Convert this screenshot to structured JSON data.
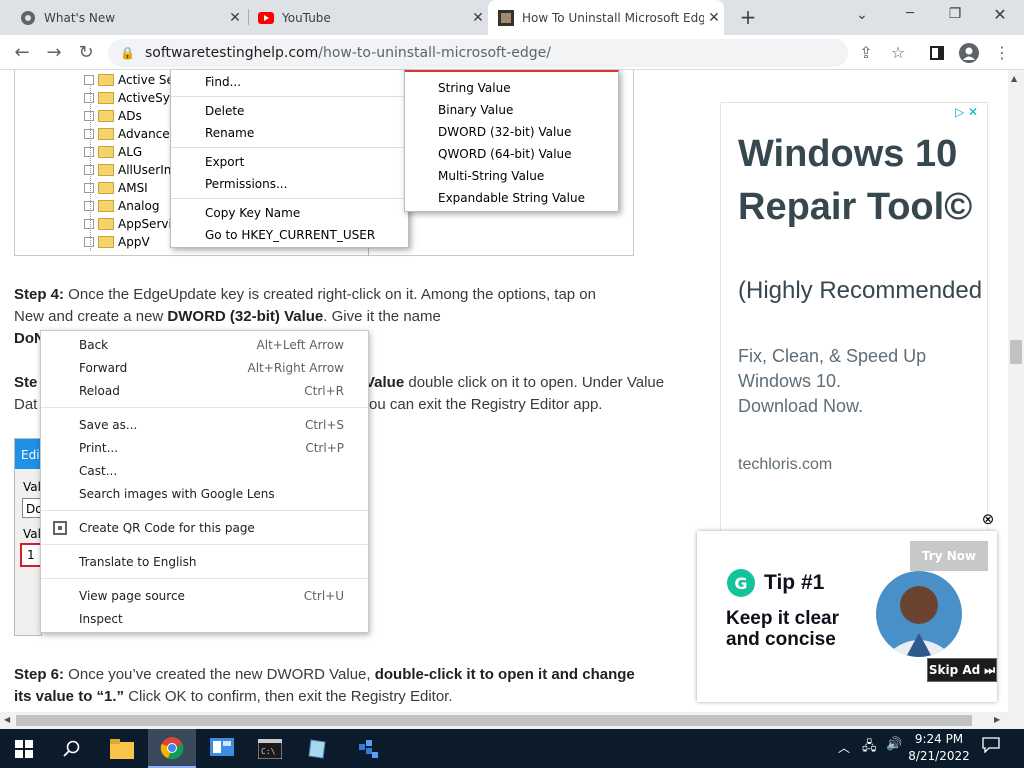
{
  "tabs": [
    {
      "title": "What's New",
      "icon": "chrome-icon"
    },
    {
      "title": "YouTube",
      "icon": "youtube-icon"
    },
    {
      "title": "How To Uninstall Microsoft Edge",
      "icon": "site-favicon"
    }
  ],
  "new_tab": "+",
  "window_controls": {
    "minimize": "─",
    "restore": "❐",
    "close": "✕",
    "tab_search": "⌄"
  },
  "address": {
    "domain": "softwaretestinghelp.com",
    "path": "/how-to-uninstall-microsoft-edge/"
  },
  "registry": {
    "tree_items": [
      "Active Set",
      "ActiveSyn",
      "ADs",
      "Advanced",
      "ALG",
      "AllUserIns",
      "AMSI",
      "Analog",
      "AppServic",
      "AppV"
    ],
    "context_items": [
      "Find...",
      "Delete",
      "Rename",
      "Export",
      "Permissions...",
      "Copy Key Name",
      "Go to HKEY_CURRENT_USER"
    ],
    "submenu_items": [
      "String Value",
      "Binary Value",
      "DWORD (32-bit) Value",
      "QWORD (64-bit) Value",
      "Multi-String Value",
      "Expandable String Value"
    ]
  },
  "article": {
    "step4_label": "Step 4:",
    "step4_text1": " Once the EdgeUpdate key is created right-click on it. Among the options, tap on",
    "step4_text2a": "New and create a new ",
    "step4_bold": "DWORD (32-bit) Value",
    "step4_text2b": ". Give it the name",
    "step4_line3": "DoN",
    "step5_label": "Ste",
    "step5_bold": "Value",
    "step5_text1": " double click on it to open. Under Value",
    "step5_line2a": "Dat",
    "step5_line2b": "ou can exit the Registry Editor app.",
    "dialog_tab": "Edi",
    "dialog_val1": "Valu",
    "dialog_field1": "Do",
    "dialog_val2": "Valu",
    "dialog_field2": "1",
    "step6_label": "Step 6:",
    "step6_text1": " Once you’ve created the new DWORD Value, ",
    "step6_bold1": "double-click it to open it and change",
    "step6_bold2": "its value to “1.”",
    "step6_text2": " Click OK to confirm, then exit the Registry Editor."
  },
  "chrome_menu": {
    "groups": [
      [
        {
          "label": "Back",
          "shortcut": "Alt+Left Arrow"
        },
        {
          "label": "Forward",
          "shortcut": "Alt+Right Arrow"
        },
        {
          "label": "Reload",
          "shortcut": "Ctrl+R"
        }
      ],
      [
        {
          "label": "Save as...",
          "shortcut": "Ctrl+S"
        },
        {
          "label": "Print...",
          "shortcut": "Ctrl+P"
        },
        {
          "label": "Cast...",
          "shortcut": ""
        },
        {
          "label": "Search images with Google Lens",
          "shortcut": ""
        }
      ],
      [
        {
          "label": "Create QR Code for this page",
          "shortcut": ""
        }
      ],
      [
        {
          "label": "Translate to English",
          "shortcut": ""
        }
      ],
      [
        {
          "label": "View page source",
          "shortcut": "Ctrl+U"
        },
        {
          "label": "Inspect",
          "shortcut": ""
        }
      ]
    ]
  },
  "ad": {
    "title1": "Windows 10",
    "title2": "Repair Tool©",
    "sub": "(Highly Recommended",
    "desc1": "Fix, Clean, & Speed Up",
    "desc2": "Windows 10.",
    "desc3": "Download Now.",
    "domain": "techloris.com",
    "adchoices": "▷ ✕"
  },
  "ad2": {
    "try_now": "Try Now",
    "tip": "Tip #1",
    "headline1": "Keep it clear",
    "headline2": "and concise",
    "skip": "Skip Ad",
    "close": "⊗"
  },
  "taskbar": {
    "time": "9:24 PM",
    "date": "8/21/2022"
  }
}
